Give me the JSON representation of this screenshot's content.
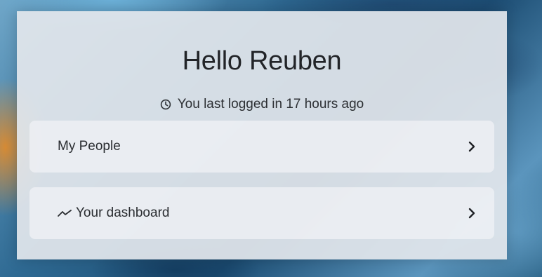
{
  "greeting": "Hello Reuben",
  "last_login": {
    "icon": "clock-icon",
    "text": "You last logged in 17 hours ago"
  },
  "nav": {
    "items": [
      {
        "label": "My People",
        "icon": null,
        "chevron": "chevron-right-icon"
      },
      {
        "label": "Your dashboard",
        "icon": "trend-line-icon",
        "chevron": "chevron-right-icon"
      }
    ]
  },
  "colors": {
    "card_background": "#e2e6ec",
    "item_background": "#f0f2f6",
    "text_primary": "#222428"
  }
}
